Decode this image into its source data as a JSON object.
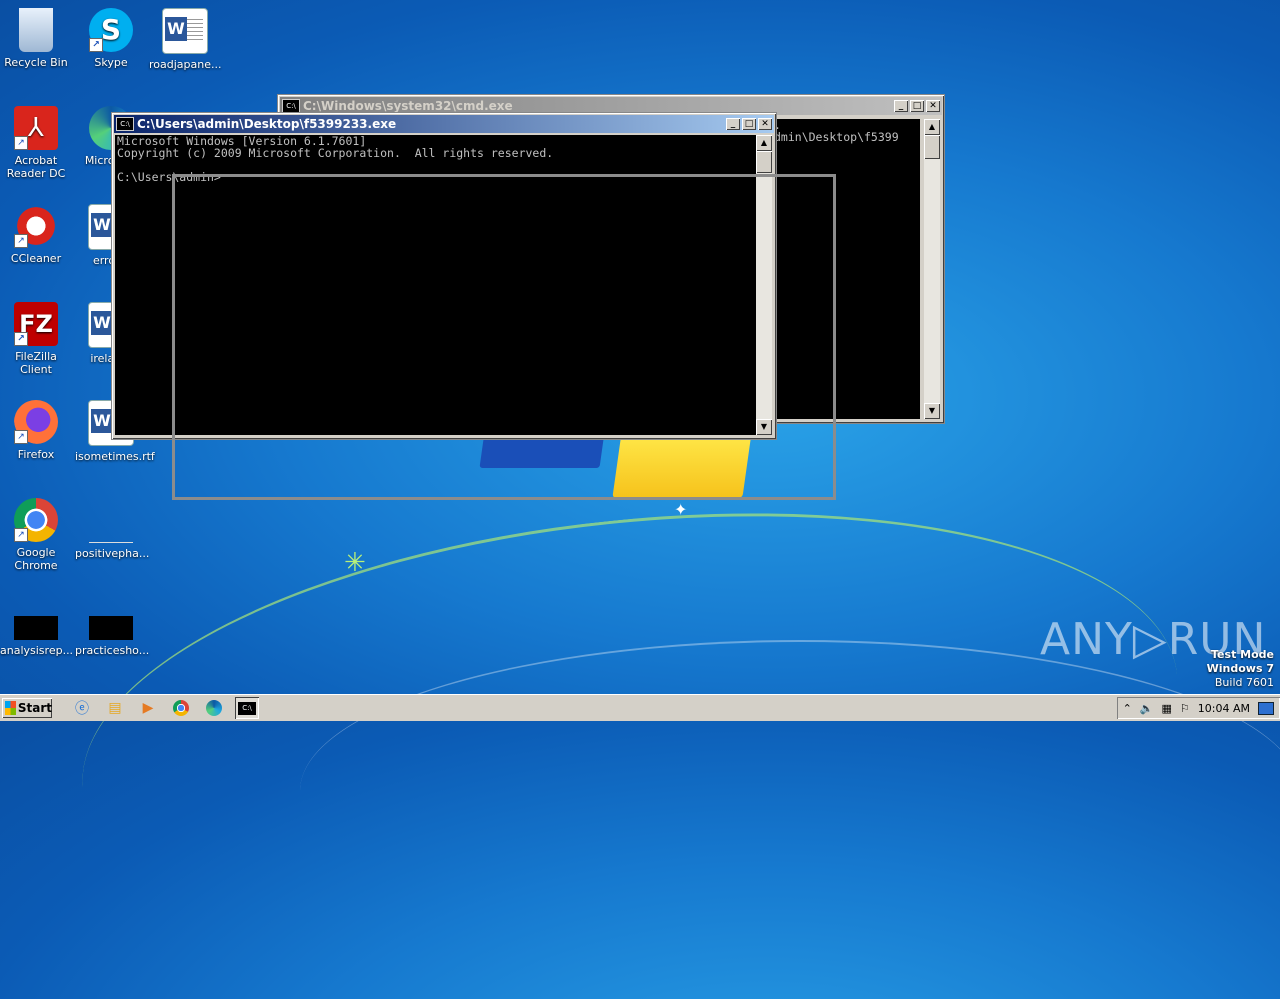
{
  "desktop": {
    "icons": [
      {
        "label": "Recycle Bin",
        "icon": "recycle-bin-icon"
      },
      {
        "label": "Skype",
        "icon": "skype-icon"
      },
      {
        "label": "roadjapane...",
        "icon": "word-document-icon"
      },
      {
        "label": "Acrobat Reader DC",
        "icon": "acrobat-icon"
      },
      {
        "label": "Microso...",
        "icon": "edge-icon"
      },
      {
        "label": "CCleaner",
        "icon": "ccleaner-icon"
      },
      {
        "label": "error...",
        "icon": "word-document-icon"
      },
      {
        "label": "FileZilla Client",
        "icon": "filezilla-icon"
      },
      {
        "label": "irelan...",
        "icon": "word-document-icon"
      },
      {
        "label": "Firefox",
        "icon": "firefox-icon"
      },
      {
        "label": "isometimes.rtf",
        "icon": "word-document-icon"
      },
      {
        "label": "Google Chrome",
        "icon": "chrome-icon"
      },
      {
        "label": "positivepha...",
        "icon": "blank-file-icon"
      },
      {
        "label": "analysisrep...",
        "icon": "black-file-icon"
      },
      {
        "label": "practicesho...",
        "icon": "black-file-icon"
      }
    ]
  },
  "back_window": {
    "title": "C:\\Windows\\system32\\cmd.exe",
    "lines": [
      ".",
      "dmin\\Desktop\\f5399"
    ]
  },
  "front_window": {
    "title": "C:\\Users\\admin\\Desktop\\f5399233.exe",
    "lines": [
      "Microsoft Windows [Version 6.1.7601]",
      "Copyright (c) 2009 Microsoft Corporation.  All rights reserved.",
      "",
      "C:\\Users\\admin>"
    ]
  },
  "window_buttons": {
    "minimize": "_",
    "maximize": "□",
    "close": "✕"
  },
  "watermark": {
    "brand": "ANY▷RUN",
    "line1": "Test Mode",
    "line2": "Windows 7",
    "line3": "Build 7601"
  },
  "taskbar": {
    "start_label": "Start",
    "pinned": [
      "ie-icon",
      "explorer-icon",
      "media-player-icon",
      "chrome-icon",
      "edge-icon",
      "cmd-icon"
    ],
    "clock": "10:04 AM"
  },
  "colors": {
    "title_active": "#0a246a",
    "console_bg": "#000000",
    "console_fg": "#c0c0c0"
  }
}
